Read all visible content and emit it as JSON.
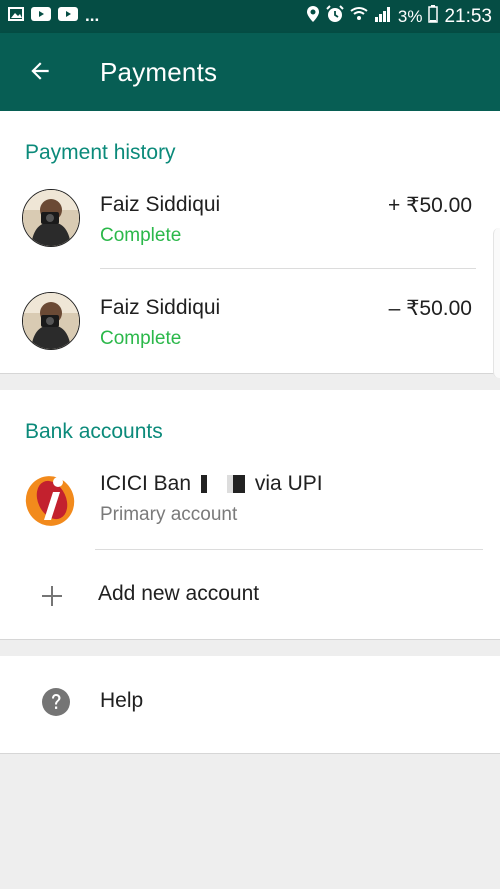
{
  "status_bar": {
    "left_icons": [
      "image-icon",
      "youtube-icon",
      "youtube-icon"
    ],
    "overflow": "...",
    "right_icons": [
      "location-icon",
      "alarm-icon",
      "wifi-icon",
      "signal-icon"
    ],
    "battery": "3%",
    "time": "21:53"
  },
  "app_bar": {
    "title": "Payments",
    "back_icon": "arrow-back-icon"
  },
  "payment_history": {
    "title": "Payment history",
    "items": [
      {
        "name": "Faiz Siddiqui",
        "status": "Complete",
        "amount": "+ ₹50.00"
      },
      {
        "name": "Faiz Siddiqui",
        "status": "Complete",
        "amount": "– ₹50.00"
      }
    ]
  },
  "bank_accounts": {
    "title": "Bank accounts",
    "accounts": [
      {
        "name_prefix": "ICICI Ban",
        "name_suffix": "via UPI",
        "subtitle": "Primary account"
      }
    ],
    "add_label": "Add new account"
  },
  "help": {
    "label": "Help"
  },
  "colors": {
    "status_bar": "#054d44",
    "app_bar": "#075e54",
    "section_title": "#0b8a7a",
    "status_complete": "#2bb84a",
    "icici_orange": "#f28a1c",
    "icici_red": "#c3212e"
  }
}
